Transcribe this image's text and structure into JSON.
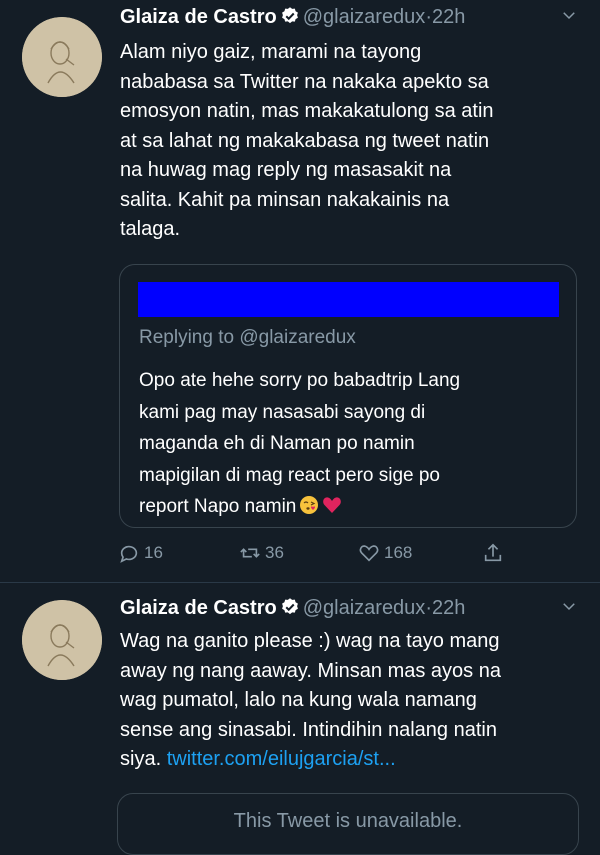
{
  "tweets": [
    {
      "author_name": "Glaiza de Castro",
      "handle": "@glaizaredux",
      "separator": "·",
      "time": "22h",
      "text": "Alam niyo gaiz, marami na tayong\nnababasa sa Twitter na nakaka apekto sa\nemosyon natin, mas makakatulong sa atin\nat sa lahat ng makakabasa ng tweet natin\nna huwag mag reply ng masasakit na\nsalita. Kahit pa minsan nakakainis na\ntalaga.",
      "quote": {
        "replying_to": "Replying to @glaizaredux",
        "text": "Opo ate hehe sorry po babadtrip Lang\nkami pag may nasasabi sayong di\nmaganda eh di Naman po namin\nmapigilan di mag react pero sige po\nreport Napo namin",
        "emojis": [
          "kissing-face-emoji",
          "red-heart-emoji"
        ]
      },
      "actions": {
        "replies": "16",
        "retweets": "36",
        "likes": "168"
      }
    },
    {
      "author_name": "Glaiza de Castro",
      "handle": "@glaizaredux",
      "separator": "·",
      "time": "22h",
      "text": "Wag na ganito please :) wag na tayo mang\naway ng nang aaway. Minsan mas ayos na\nwag pumatol, lalo na kung wala namang\nsense ang sinasabi. Intindihin nalang natin\nsiya. ",
      "link": "twitter.com/eilujgarcia/st...",
      "quote_unavailable": "This Tweet is unavailable."
    }
  ],
  "icons": [
    "verified-badge-icon",
    "chevron-down-icon",
    "reply-icon",
    "retweet-icon",
    "like-icon",
    "share-icon"
  ],
  "colors": {
    "background": "#141d26",
    "text": "#ffffff",
    "muted": "#8899a6",
    "link": "#1da1f2",
    "verified": "#ffffff",
    "redacted_banner": "#0000ff"
  }
}
